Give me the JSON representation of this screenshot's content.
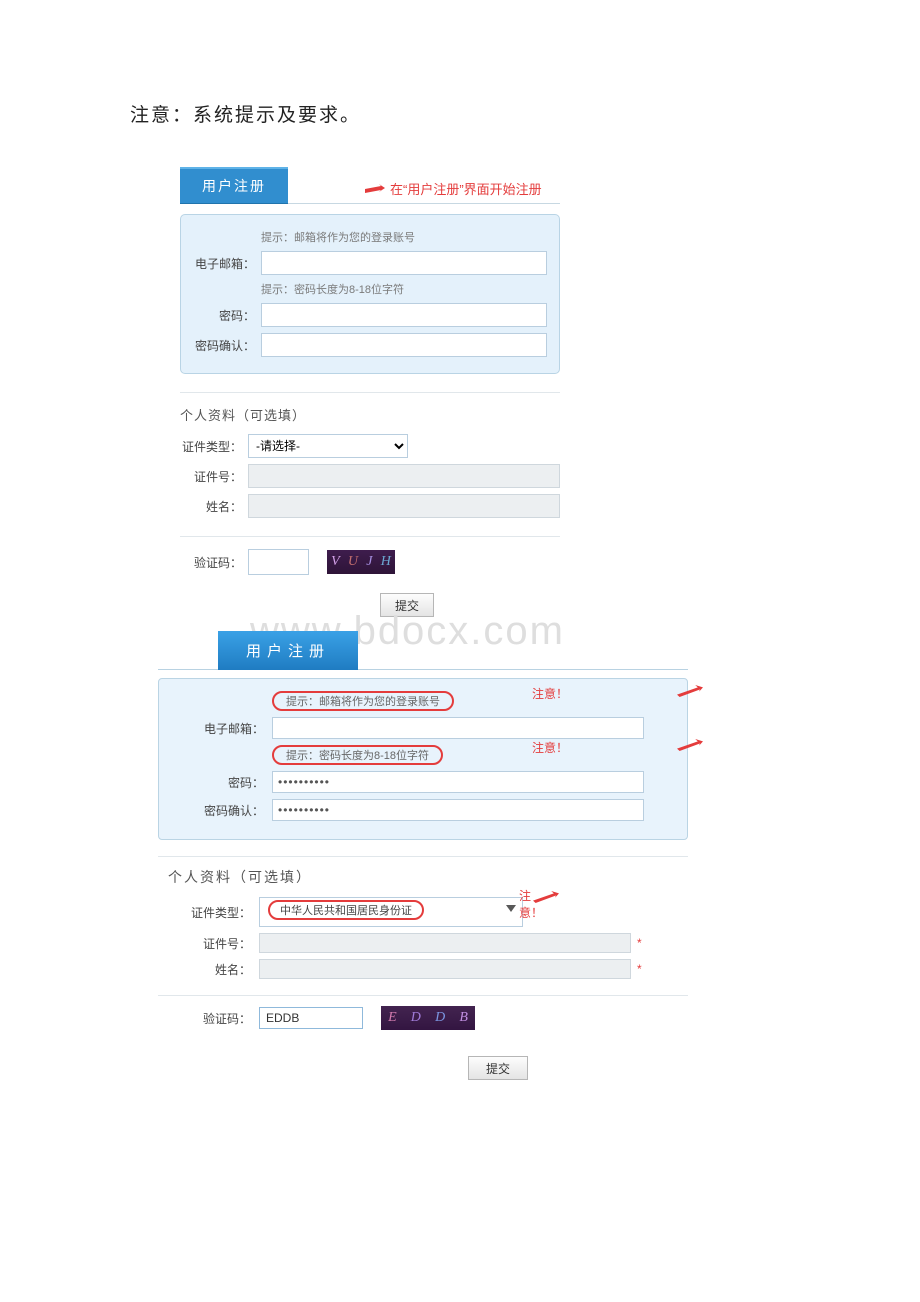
{
  "heading": "注意：系统提示及要求。",
  "tab_label": "用户注册",
  "watermark": "www.bdocx.com",
  "form1": {
    "top_note": "在“用户注册”界面开始注册",
    "hint_email": "提示：邮箱将作为您的登录账号",
    "label_email": "电子邮箱：",
    "hint_pw": "提示：密码长度为8-18位字符",
    "label_pw": "密码：",
    "label_pw2": "密码确认：",
    "subhead": "个人资料（可选填）",
    "label_idtype": "证件类型：",
    "sel_default": "-请选择-",
    "label_idno": "证件号：",
    "label_name": "姓名：",
    "label_captcha": "验证码：",
    "captcha": [
      "V",
      "U",
      "J",
      "H"
    ],
    "submit": "提交"
  },
  "form2": {
    "hint_email": "提示：邮箱将作为您的登录账号",
    "warn": "注意！",
    "label_email": "电子邮箱：",
    "hint_pw": "提示：密码长度为8-18位字符",
    "label_pw": "密码：",
    "label_pw2": "密码确认：",
    "pw_value": "••••••••••",
    "subhead": "个人资料（可选填）",
    "label_idtype": "证件类型：",
    "sel_value": "中华人民共和国居民身份证",
    "label_idno": "证件号：",
    "label_name": "姓名：",
    "label_captcha": "验证码：",
    "captcha_value": "EDDB",
    "captcha_img": [
      "E",
      "D",
      "D",
      "B"
    ],
    "submit": "提交"
  }
}
